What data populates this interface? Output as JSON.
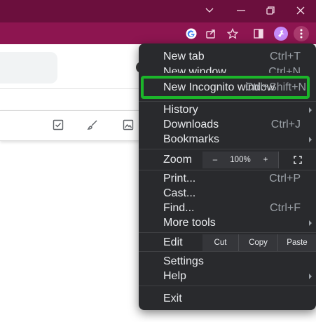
{
  "window": {
    "controls": [
      "dropdown",
      "minimize",
      "restore",
      "close"
    ]
  },
  "toolbar": {
    "icons": [
      "google-icon",
      "share-icon",
      "star-icon",
      "sidebar-icon",
      "extension-icon",
      "menu-icon"
    ]
  },
  "colors": {
    "titlebar": "#6b0f3d",
    "toolbar": "#8d1550",
    "menu_bg": "#292a2d",
    "highlight": "#1cb52a"
  },
  "menu": {
    "new_tab": {
      "label": "New tab",
      "shortcut": "Ctrl+T"
    },
    "new_window": {
      "label": "New window",
      "shortcut": "Ctrl+N"
    },
    "new_incognito": {
      "label": "New Incognito window",
      "shortcut": "Ctrl+Shift+N"
    },
    "history": {
      "label": "History"
    },
    "downloads": {
      "label": "Downloads",
      "shortcut": "Ctrl+J"
    },
    "bookmarks": {
      "label": "Bookmarks"
    },
    "zoom": {
      "label": "Zoom",
      "minus": "–",
      "value": "100%",
      "plus": "+"
    },
    "print": {
      "label": "Print...",
      "shortcut": "Ctrl+P"
    },
    "cast": {
      "label": "Cast..."
    },
    "find": {
      "label": "Find...",
      "shortcut": "Ctrl+F"
    },
    "more_tools": {
      "label": "More tools"
    },
    "edit": {
      "label": "Edit",
      "cut": "Cut",
      "copy": "Copy",
      "paste": "Paste"
    },
    "settings": {
      "label": "Settings"
    },
    "help": {
      "label": "Help"
    },
    "exit": {
      "label": "Exit"
    }
  }
}
